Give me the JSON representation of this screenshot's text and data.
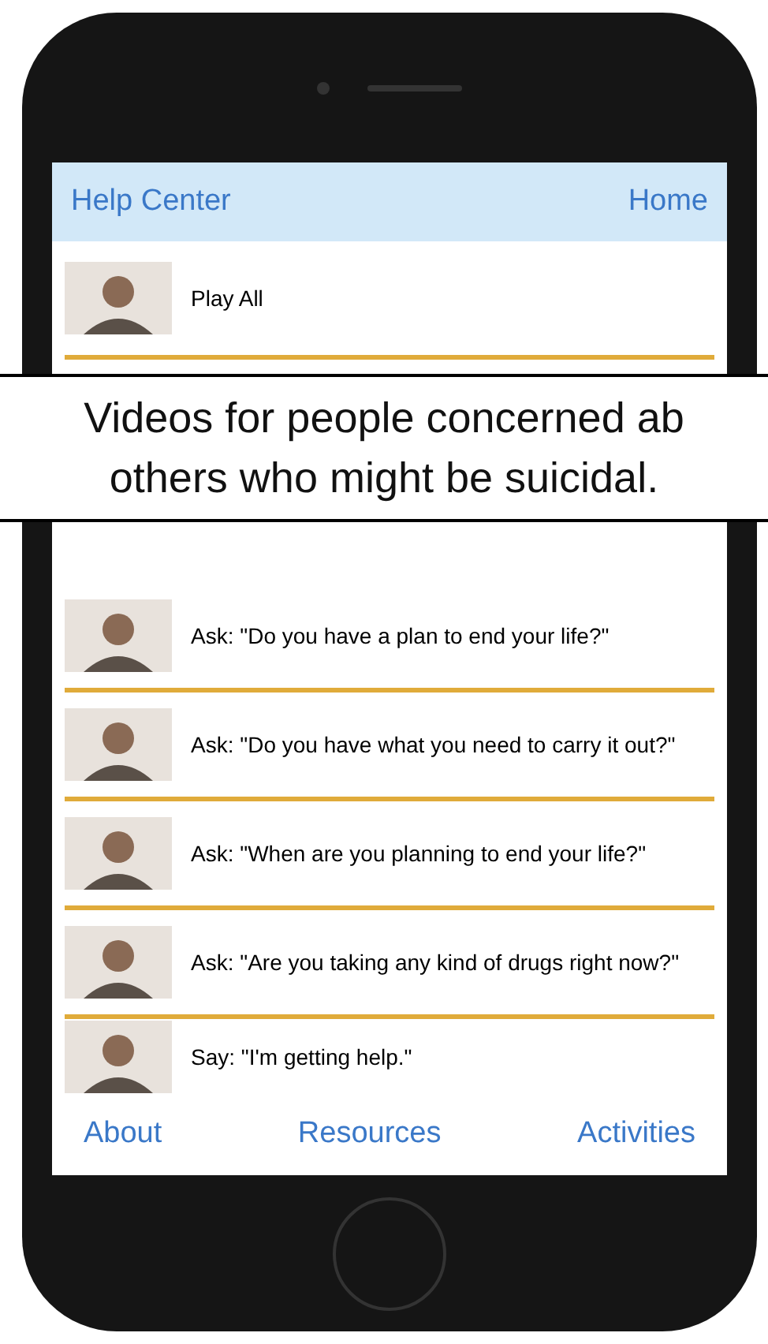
{
  "nav_bar": {
    "left": "Help Center",
    "right": "Home"
  },
  "play_all": {
    "label": "Play All"
  },
  "caption": {
    "lines": [
      "Videos for people concerned ab",
      "others who might be suicidal."
    ]
  },
  "videos": [
    {
      "label": "Ask: \"Do you have a plan to end your life?\""
    },
    {
      "label": "Ask: \"Do you have what you need to carry it out?\""
    },
    {
      "label": "Ask: \"When are you planning to end your life?\""
    },
    {
      "label": "Ask: \"Are you taking any kind of drugs right now?\""
    },
    {
      "label": "Say: \"I'm getting help.\""
    }
  ],
  "tab_bar": [
    "About",
    "Resources",
    "Activities"
  ]
}
